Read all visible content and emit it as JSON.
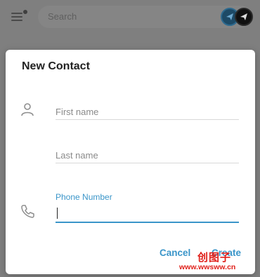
{
  "header": {
    "search_placeholder": "Search",
    "menu_icon": "hamburger-menu-icon",
    "story_icons": [
      "telegram-avatar-icon",
      "telegram-avatar-icon"
    ]
  },
  "dialog": {
    "title": "New Contact",
    "first_name": {
      "placeholder": "First name",
      "value": "",
      "icon": "person-icon"
    },
    "last_name": {
      "placeholder": "Last name",
      "value": ""
    },
    "phone": {
      "label": "Phone Number",
      "value": "",
      "icon": "phone-icon"
    },
    "cancel_label": "Cancel",
    "create_label": "Create"
  },
  "watermark": {
    "logo": "创图子",
    "url": "www.wwsww.cn"
  },
  "colors": {
    "accent": "#3a95c9",
    "overlay": "#7f7f7f"
  }
}
